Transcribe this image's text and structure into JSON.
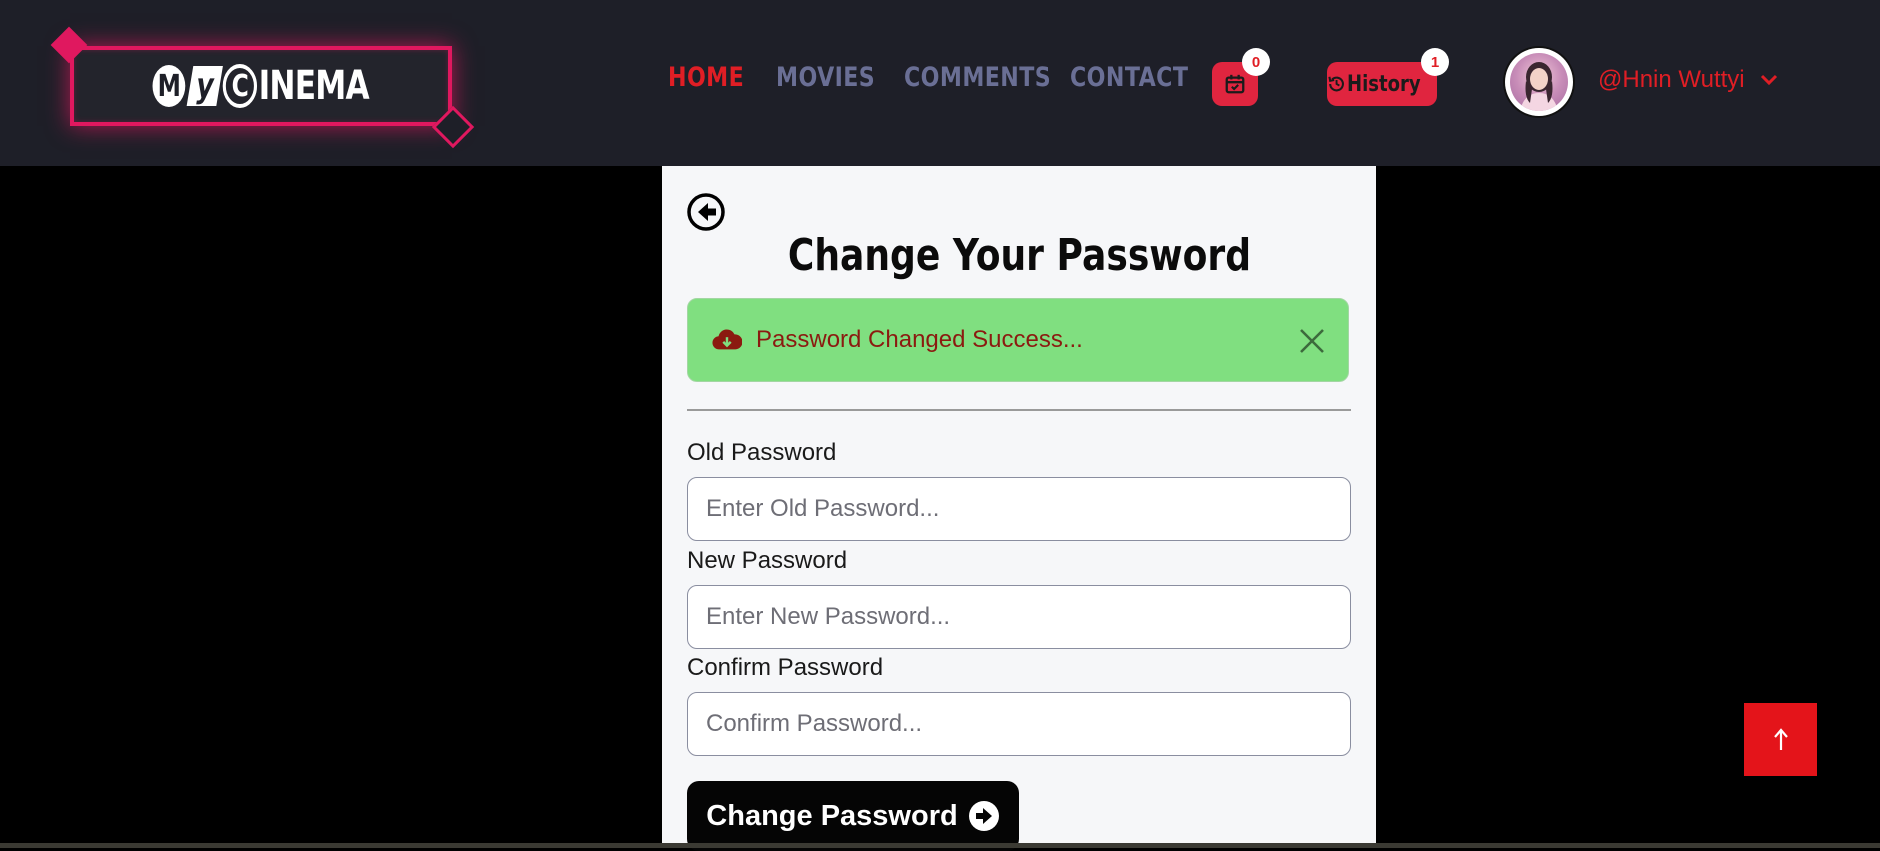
{
  "logo": {
    "char1": "M",
    "char2": "y",
    "char3": "C",
    "rest": "INEMA"
  },
  "nav": {
    "links": [
      {
        "label": "HOME",
        "active": true
      },
      {
        "label": "MOVIES",
        "active": false
      },
      {
        "label": "COMMENTS",
        "active": false
      },
      {
        "label": "CONTACT",
        "active": false
      }
    ],
    "booking_count": "0",
    "history_label": "History",
    "history_count": "1",
    "user_name": "@Hnin Wuttyi"
  },
  "card": {
    "title": "Change Your Password",
    "alert_text": "Password Changed Success...",
    "fields": [
      {
        "label": "Old Password",
        "placeholder": "Enter Old Password..."
      },
      {
        "label": "New Password",
        "placeholder": "Enter New Password..."
      },
      {
        "label": "Confirm Password",
        "placeholder": "Confirm Password..."
      }
    ],
    "submit_label": "Change Password"
  },
  "colors": {
    "accent": "#e01e25",
    "nav_bg": "#1e1f28",
    "nav_link": "#6a6f95",
    "alert_bg": "#80df80",
    "alert_text": "#8b1a10",
    "logo_border": "#e0185f"
  },
  "icons": {
    "back": "arrow-left-circle-icon",
    "booking": "calendar-check-icon",
    "history": "history-icon",
    "alert": "cloud-download-icon",
    "close": "close-icon",
    "submit": "arrow-right-circle-icon",
    "scroll_top": "arrow-up-icon",
    "user_menu": "chevron-down-icon"
  }
}
